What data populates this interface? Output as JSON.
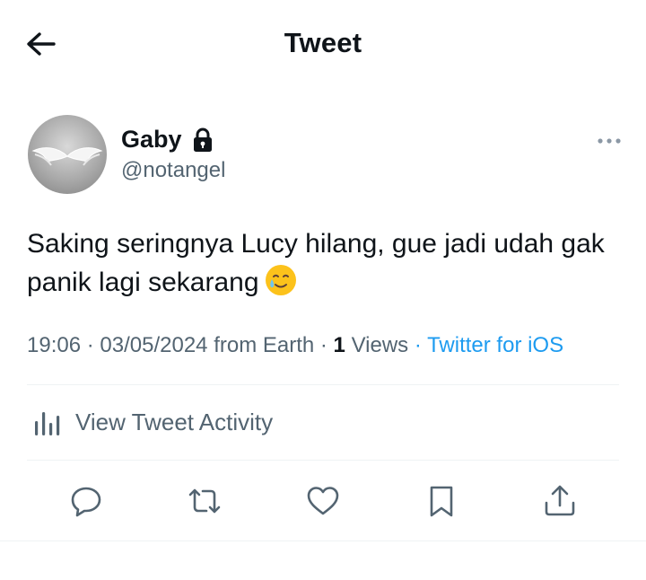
{
  "header": {
    "title": "Tweet",
    "back_icon": "arrow-left-icon"
  },
  "author": {
    "name": "Gaby",
    "handle": "@notangel",
    "protected_icon": "lock-icon",
    "avatar": "angel-wings-avatar"
  },
  "tweet": {
    "text": "Saking seringnya Lucy hilang, gue jadi udah gak panik lagi sekarang",
    "emoji": "smiling-face-with-tear-emoji"
  },
  "meta": {
    "time": "19:06",
    "date": "03/05/2024",
    "location": "from Earth",
    "views_count": "1",
    "views_label": "Views",
    "source": "Twitter for iOS"
  },
  "activity": {
    "label": "View Tweet Activity",
    "icon": "analytics-icon"
  },
  "actions": [
    "reply-icon",
    "retweet-icon",
    "like-icon",
    "bookmark-icon",
    "share-icon"
  ],
  "colors": {
    "text": "#0f1419",
    "secondary": "#536471",
    "link": "#1d9bf0",
    "divider": "#eff3f4"
  }
}
